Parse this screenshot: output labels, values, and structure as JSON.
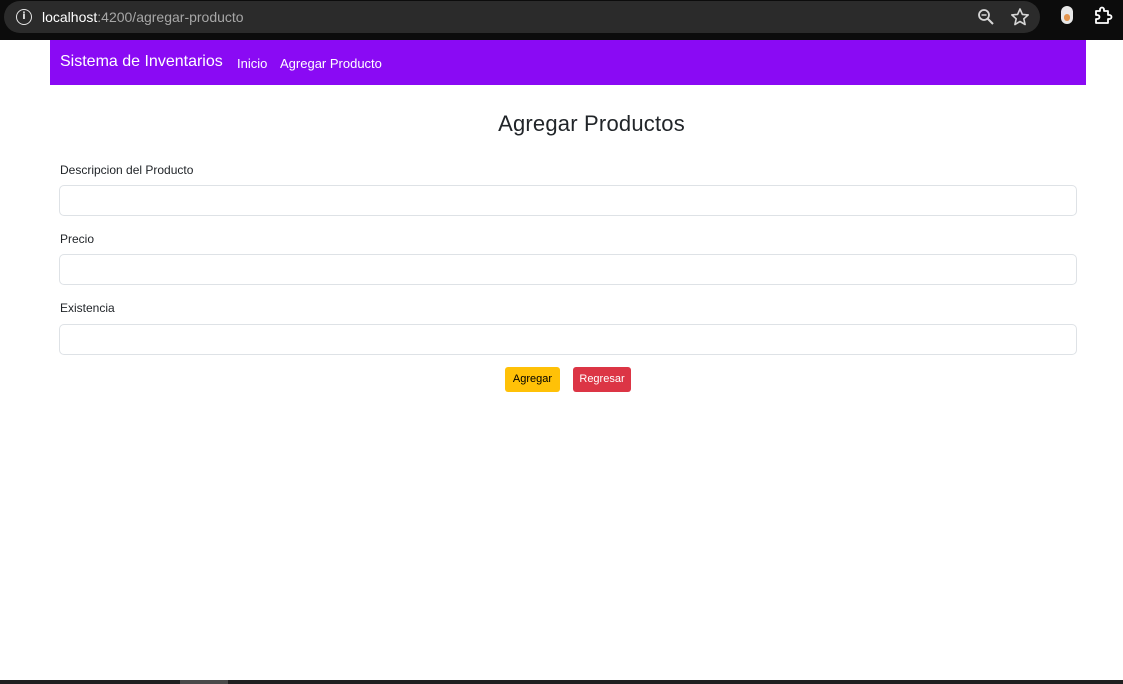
{
  "browser": {
    "url_host": "localhost",
    "url_path": ":4200/agregar-producto"
  },
  "navbar": {
    "brand": "Sistema de Inventarios",
    "links": [
      {
        "label": "Inicio"
      },
      {
        "label": "Agregar Producto"
      }
    ],
    "background_color": "#8a0af4"
  },
  "main": {
    "title": "Agregar Productos",
    "fields": [
      {
        "label": "Descripcion del Producto",
        "value": ""
      },
      {
        "label": "Precio",
        "value": ""
      },
      {
        "label": "Existencia",
        "value": ""
      }
    ],
    "buttons": {
      "add_label": "Agregar",
      "back_label": "Regresar"
    }
  },
  "colors": {
    "add_button": "#ffc107",
    "back_button": "#dc3545"
  },
  "icons": [
    "site-info-icon",
    "zoom-icon",
    "star-icon",
    "extension-avatar-icon",
    "extensions-icon"
  ]
}
